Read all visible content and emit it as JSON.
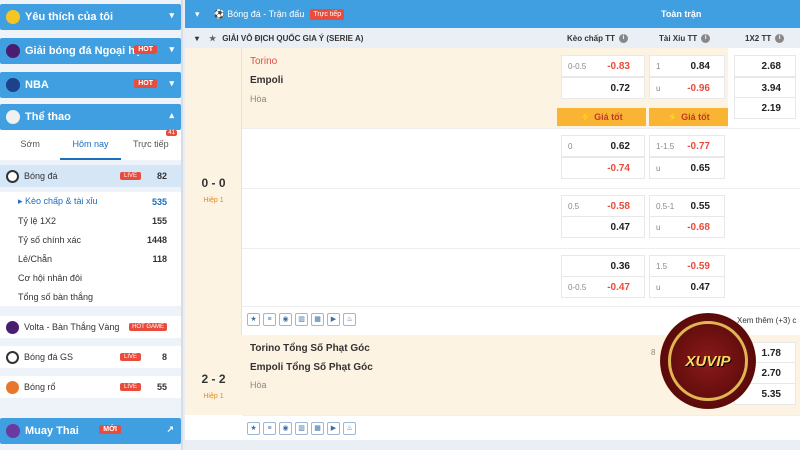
{
  "sidebar": {
    "favorites": "Yêu thích của tôi",
    "premier": "Giải bóng đá Ngoại hạn...",
    "premier_badge": "HOT",
    "nba": "NBA",
    "nba_badge": "HOT",
    "sports": "Thể thao",
    "tabs": [
      {
        "label": "Sớm"
      },
      {
        "label": "Hôm nay"
      },
      {
        "label": "Trực tiếp",
        "badge": "41"
      }
    ],
    "football": {
      "label": "Bóng đá",
      "badge": "LIVE",
      "count": "82"
    },
    "subs": [
      {
        "label": "▸ Kèo chấp & tài xỉu",
        "count": "535"
      },
      {
        "label": "Tỷ lệ 1X2",
        "count": "155"
      },
      {
        "label": "Tỷ số chính xác",
        "count": "1448"
      },
      {
        "label": "Lẻ/Chẵn",
        "count": "118"
      },
      {
        "label": "Cơ hội nhân đôi",
        "count": ""
      },
      {
        "label": "Tổng số bàn thắng",
        "count": ""
      }
    ],
    "volta": {
      "label": "Volta - Bàn Thắng Vàng",
      "badge": "HOT GAME"
    },
    "gs": {
      "label": "Bóng đá GS",
      "badge": "LIVE",
      "count": "8"
    },
    "basket": {
      "label": "Bóng rổ",
      "badge": "LIVE",
      "count": "55"
    },
    "muay": "Muay Thai",
    "muay_badge": "MỚI"
  },
  "main": {
    "title": "Bóng đá - Trận đấu",
    "live_tag": "Trực tiếp",
    "full_match": "Toàn trận",
    "league": "GIẢI VÔ ĐỊCH QUỐC GIA Ý (SERIE A)",
    "col_handicap": "Kèo chấp TT",
    "col_ou": "Tài Xỉu TT",
    "col_1x2": "1X2 TT",
    "match1": {
      "score": "0 - 0",
      "half": "Hiệp 1",
      "home": "Torino",
      "away": "Empoli",
      "draw": "Hòa",
      "best": "Giá tốt"
    },
    "rows": [
      {
        "hc": "0-0.5",
        "h1": "-0.83",
        "h2": "0.72",
        "ouhc": "1",
        "o1": "0.84",
        "ouu": "u",
        "o2": "-0.96"
      },
      {
        "hc": "0",
        "h1": "0.62",
        "h2": "-0.74",
        "ouhc": "1-1.5",
        "o1": "-0.77",
        "ouu": "u",
        "o2": "0.65"
      },
      {
        "hc": "0.5",
        "h1": "-0.58",
        "h2": "0.47",
        "ouhc": "0.5-1",
        "o1": "0.55",
        "ouu": "u",
        "o2": "-0.68"
      },
      {
        "hc": "0-0.5",
        "h1": "0.36",
        "h2": "-0.47",
        "ouhc": "1.5",
        "o1": "-0.59",
        "ouu": "u",
        "o2": "0.47"
      }
    ],
    "x12": [
      "2.68",
      "3.94",
      "2.19"
    ],
    "see_more": "Xem thêm (+3) c",
    "match2": {
      "score": "2 - 2",
      "half": "Hiệp 1",
      "home": "Torino Tổng Số Phạt Góc",
      "away": "Empoli Tổng Số Phạt Góc",
      "draw": "Hòa",
      "x12": [
        "1.78",
        "2.70",
        "5.35"
      ],
      "partial": "8"
    },
    "logo_text": "XUVIP"
  },
  "colors": {
    "blue": "#3f9fe0",
    "red": "#e84c3d",
    "orange": "#f8b432",
    "cream": "#fdf3e2"
  }
}
